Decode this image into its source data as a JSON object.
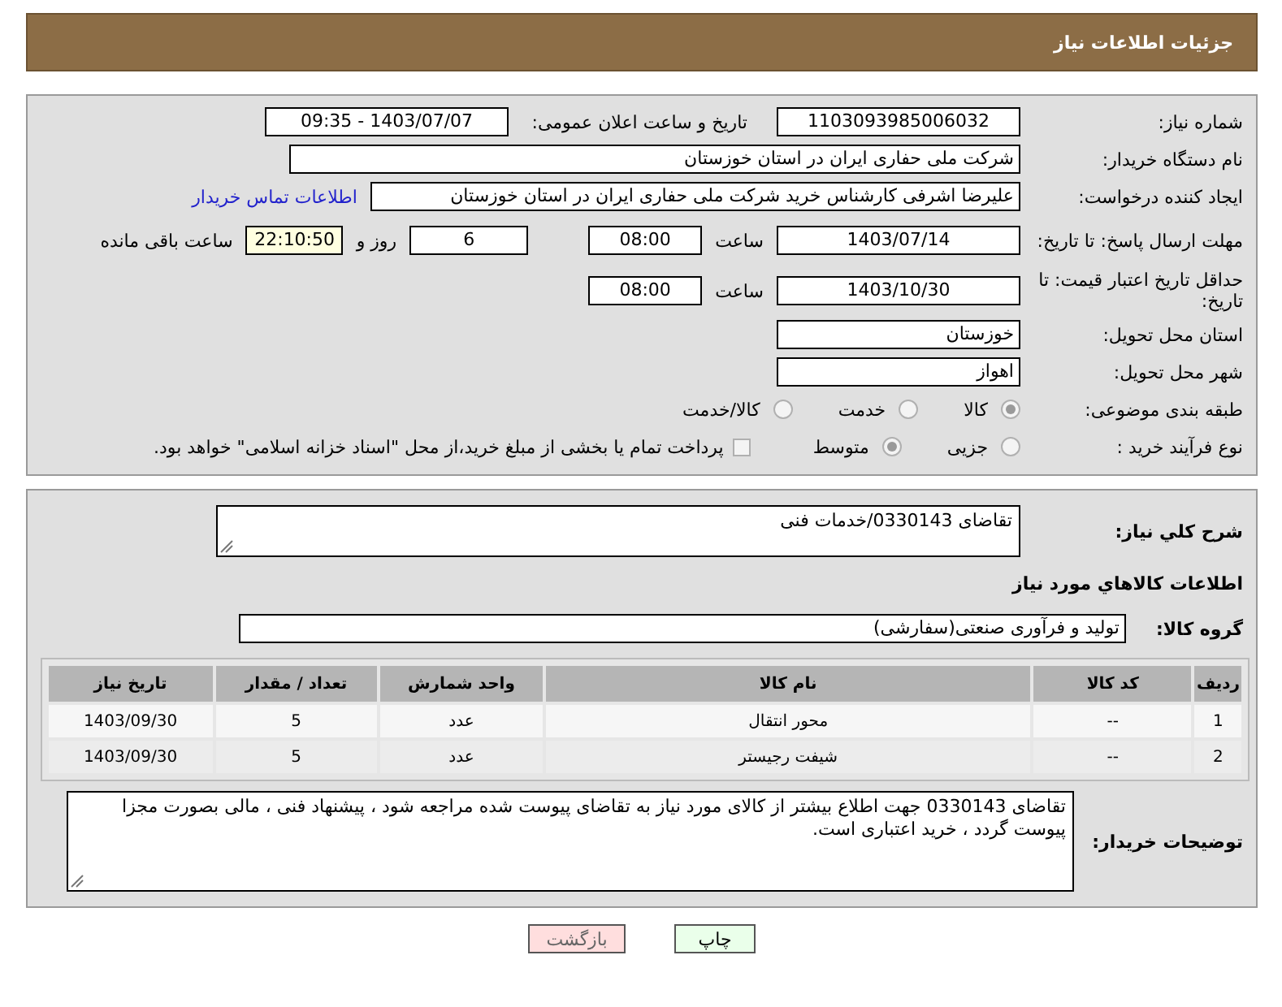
{
  "header": {
    "title": "جزئیات اطلاعات نیاز"
  },
  "need_number": {
    "label": "شماره نیاز:",
    "value": "1103093985006032"
  },
  "announce": {
    "label": "تاریخ و ساعت اعلان عمومی:",
    "value": "1403/07/07 - 09:35"
  },
  "buyer_org": {
    "label": "نام دستگاه خریدار:",
    "value": "شرکت ملی حفاری ایران در استان خوزستان"
  },
  "requester": {
    "label": "ایجاد کننده درخواست:",
    "value": "علیرضا اشرفی کارشناس خرید شرکت ملی حفاری ایران در استان خوزستان",
    "link": "اطلاعات تماس خریدار"
  },
  "deadline": {
    "label": "مهلت ارسال پاسخ: تا تاریخ:",
    "date": "1403/07/14",
    "time_label": "ساعت",
    "time": "08:00",
    "days": "6",
    "days_label": "روز و",
    "remaining": "22:10:50",
    "remaining_label": "ساعت باقی مانده"
  },
  "validity": {
    "label": "حداقل تاریخ اعتبار قیمت: تا تاریخ:",
    "date": "1403/10/30",
    "time_label": "ساعت",
    "time": "08:00"
  },
  "province": {
    "label": "استان محل تحویل:",
    "value": "خوزستان"
  },
  "city": {
    "label": "شهر محل تحویل:",
    "value": "اهواز"
  },
  "category": {
    "label": "طبقه بندی موضوعی:",
    "options": [
      {
        "label": "کالا",
        "selected": true
      },
      {
        "label": "خدمت",
        "selected": false
      },
      {
        "label": "کالا/خدمت",
        "selected": false
      }
    ]
  },
  "process": {
    "label": "نوع فرآیند خرید :",
    "options": [
      {
        "label": "جزیی",
        "selected": false
      },
      {
        "label": "متوسط",
        "selected": true
      }
    ],
    "checkbox": {
      "label": "پرداخت تمام یا بخشی از مبلغ خرید،از محل \"اسناد خزانه اسلامی\" خواهد بود.",
      "checked": false
    }
  },
  "description": {
    "label": "شرح کلي نياز:",
    "value": "تقاضای 0330143/خدمات فنی"
  },
  "goods_heading": "اطلاعات کالاهاي مورد نياز",
  "goods_group": {
    "label": "گروه کالا:",
    "value": "تولید و فرآوری صنعتی(سفارشی)"
  },
  "table": {
    "columns": [
      "ردیف",
      "کد کالا",
      "نام کالا",
      "واحد شمارش",
      "تعداد / مقدار",
      "تاریخ نیاز"
    ],
    "rows": [
      [
        "1",
        "--",
        "محور انتقال",
        "عدد",
        "5",
        "1403/09/30"
      ],
      [
        "2",
        "--",
        "شیفت رجیستر",
        "عدد",
        "5",
        "1403/09/30"
      ]
    ]
  },
  "buyer_notes": {
    "label": "توضیحات خریدار:",
    "value": "تقاضای 0330143 جهت اطلاع بیشتر از کالای مورد نیاز به تقاضای پیوست شده مراجعه شود ، پیشنهاد فنی ، مالی بصورت مجزا پیوست گردد ، خرید اعتباری است."
  },
  "buttons": [
    {
      "label": "چاپ",
      "kind": "print"
    },
    {
      "label": "بازگشت",
      "kind": "back"
    }
  ]
}
